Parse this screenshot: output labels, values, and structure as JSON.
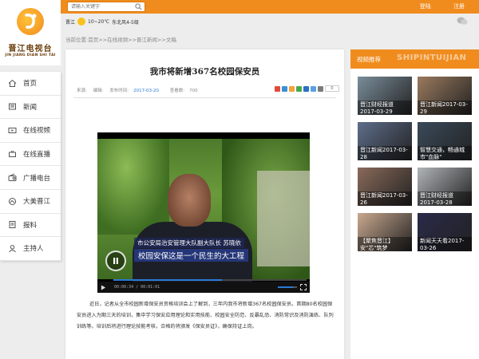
{
  "header": {
    "search_placeholder": "请输入关键字",
    "login_label": "登陆",
    "register_label": "注册"
  },
  "logo": {
    "name_cn": "晋江电视台",
    "name_en": "JIN JIANG DIAN SHI TAI"
  },
  "weather": {
    "city": "晋江",
    "temp": "10~20℃",
    "wind": "东北风4-5级"
  },
  "breadcrumb": {
    "text": "当前位置:首页>>在线视频>>晋江新闻>>文稿"
  },
  "nav": {
    "items": [
      {
        "label": "首页",
        "icon": "home-icon"
      },
      {
        "label": "新闻",
        "icon": "news-icon"
      },
      {
        "label": "在线视频",
        "icon": "video-icon"
      },
      {
        "label": "在线直播",
        "icon": "live-icon"
      },
      {
        "label": "广播电台",
        "icon": "radio-icon"
      },
      {
        "label": "大美晋江",
        "icon": "scenery-icon"
      },
      {
        "label": "报料",
        "icon": "report-icon"
      },
      {
        "label": "主持人",
        "icon": "host-icon"
      }
    ]
  },
  "article": {
    "title": "我市将新增367名校园保安员",
    "source_label": "来源:",
    "editor_label": "编辑:",
    "published_label": "发布时间:",
    "published_value": "2017-03-20",
    "views_label": "查看数:",
    "views_value": "700",
    "share_count": "0",
    "body": "近日，记者从全市校园新增保安员资格培训会上了解到，三年内我市将新增367名校园保安员。首期80名校园保安员进入为期三天的培训，集中学习保安应用理论和实用技能、校园安全防范、反暴乱恐、消防常识及消防演练、队列训练等。培训后将进行理论技能考核，合格的将颁发《保安员证》，确保持证上岗。"
  },
  "video": {
    "caption_line1": "市公安局治安管理大队副大队长  苏晓依",
    "caption_line2": "校园安保这是一个民生的大工程",
    "time": "00:00:34 / 00:01:01",
    "progress": 0.56,
    "volume": 0.8
  },
  "recommend": {
    "title_cn": "视频推荐",
    "title_en": "SHIPINTUIJIAN",
    "items": [
      {
        "caption": "晋江财经报道2017-03-29",
        "bg": "#7a8d9a"
      },
      {
        "caption": "晋江新闻2017-03-29",
        "bg": "#9a7a5e"
      },
      {
        "caption": "晋江新闻2017-03-28",
        "bg": "#5e6e8a"
      },
      {
        "caption": "智慧交通，畅通城市\"血脉\"",
        "bg": "#3a4a5a"
      },
      {
        "caption": "晋江新闻2017-03-26",
        "bg": "#8a6a5a"
      },
      {
        "caption": "晋江财经报道2017-03-28",
        "bg": "#b0b4b8"
      },
      {
        "caption": "【聚焦晋江】安\"芯\"筑梦",
        "bg": "#c9a88f"
      },
      {
        "caption": "新闻天天看2017-03-26",
        "bg": "#2a2a4a"
      }
    ]
  }
}
